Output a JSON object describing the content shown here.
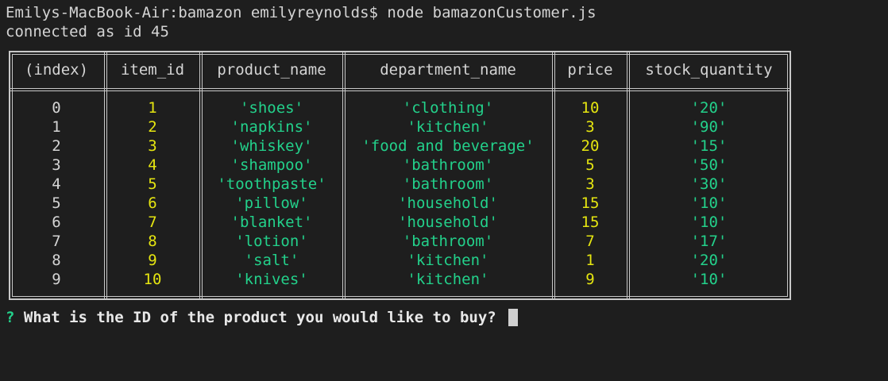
{
  "terminal": {
    "command_line": "Emilys-MacBook-Air:bamazon emilyreynolds$ node bamazonCustomer.js",
    "connection_line": "connected as id 45"
  },
  "table": {
    "headers": [
      "(index)",
      "item_id",
      "product_name",
      "department_name",
      "price",
      "stock_quantity"
    ],
    "rows": [
      {
        "index": "0",
        "item_id": "1",
        "product_name": "'shoes'",
        "department_name": "'clothing'",
        "price": "10",
        "stock_quantity": "'20'"
      },
      {
        "index": "1",
        "item_id": "2",
        "product_name": "'napkins'",
        "department_name": "'kitchen'",
        "price": "3",
        "stock_quantity": "'90'"
      },
      {
        "index": "2",
        "item_id": "3",
        "product_name": "'whiskey'",
        "department_name": "'food and beverage'",
        "price": "20",
        "stock_quantity": "'15'"
      },
      {
        "index": "3",
        "item_id": "4",
        "product_name": "'shampoo'",
        "department_name": "'bathroom'",
        "price": "5",
        "stock_quantity": "'50'"
      },
      {
        "index": "4",
        "item_id": "5",
        "product_name": "'toothpaste'",
        "department_name": "'bathroom'",
        "price": "3",
        "stock_quantity": "'30'"
      },
      {
        "index": "5",
        "item_id": "6",
        "product_name": "'pillow'",
        "department_name": "'household'",
        "price": "15",
        "stock_quantity": "'10'"
      },
      {
        "index": "6",
        "item_id": "7",
        "product_name": "'blanket'",
        "department_name": "'household'",
        "price": "15",
        "stock_quantity": "'10'"
      },
      {
        "index": "7",
        "item_id": "8",
        "product_name": "'lotion'",
        "department_name": "'bathroom'",
        "price": "7",
        "stock_quantity": "'17'"
      },
      {
        "index": "8",
        "item_id": "9",
        "product_name": "'salt'",
        "department_name": "'kitchen'",
        "price": "1",
        "stock_quantity": "'20'"
      },
      {
        "index": "9",
        "item_id": "10",
        "product_name": "'knives'",
        "department_name": "'kitchen'",
        "price": "9",
        "stock_quantity": "'10'"
      }
    ]
  },
  "prompt": {
    "marker": "?",
    "question": "What is the ID of the product you would like to buy?"
  },
  "colors": {
    "background": "#1e1e1e",
    "text": "#d4d4d4",
    "number": "#e5e510",
    "string": "#23d18b"
  }
}
